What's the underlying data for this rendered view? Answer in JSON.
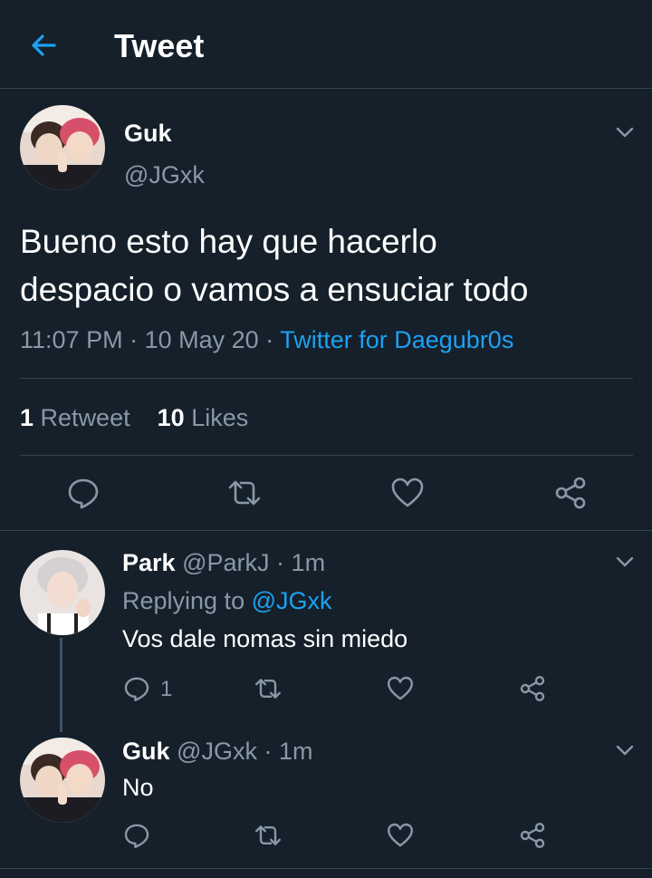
{
  "header": {
    "title": "Tweet",
    "back_icon": "arrow-left-icon",
    "accent": "#1da1f2"
  },
  "main_tweet": {
    "author_name": "Guk",
    "author_handle": "@JGxk",
    "text_line1": "Bueno esto hay que hacerlo",
    "text_line2": "despacio o vamos a ensuciar todo",
    "time": "11:07 PM",
    "sep1": "·",
    "date": "10 May 20",
    "sep2": "·",
    "client": "Twitter for Daegubr0s",
    "retweet_count": "1",
    "retweet_label": "Retweet",
    "like_count": "10",
    "like_label": "Likes",
    "actions": [
      "reply-icon",
      "retweet-icon",
      "like-icon",
      "share-icon"
    ]
  },
  "replies": [
    {
      "name": "Park",
      "handle": "@ParkJ",
      "sep": "·",
      "time": "1m",
      "replying_prefix": "Replying to",
      "replying_to": "@JGxk",
      "text": "Vos dale nomas sin miedo",
      "reply_count": "1"
    },
    {
      "name": "Guk",
      "handle": "@JGxk",
      "sep": "·",
      "time": "1m",
      "text": "No"
    }
  ]
}
